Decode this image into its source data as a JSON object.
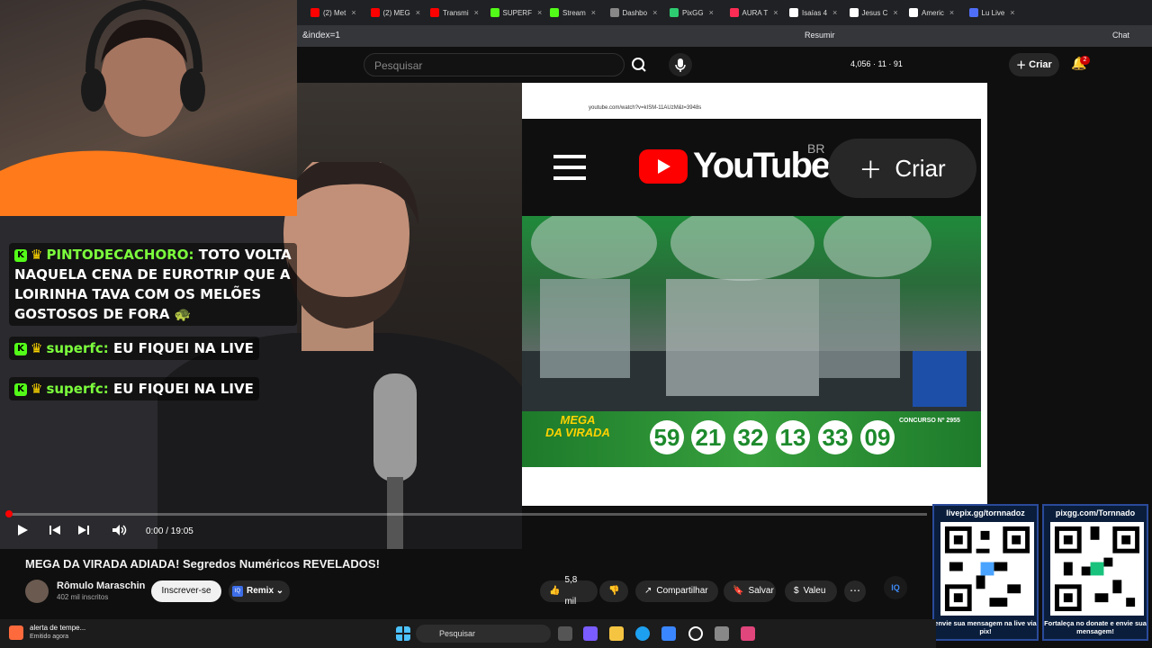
{
  "browser": {
    "tabs": [
      {
        "label": "(2) Met",
        "color": "#ff0000"
      },
      {
        "label": "(2) MEG",
        "color": "#ff0000"
      },
      {
        "label": "Transmi",
        "color": "#ff0000"
      },
      {
        "label": "SUPERF",
        "color": "#53fc18"
      },
      {
        "label": "Stream",
        "color": "#53fc18"
      },
      {
        "label": "Dashbo",
        "color": "#888888"
      },
      {
        "label": "PixGG",
        "color": "#2ecc71"
      },
      {
        "label": "AURA T",
        "color": "#ff2d55"
      },
      {
        "label": "Isaías 4",
        "color": "#ffffff"
      },
      {
        "label": "Jesus C",
        "color": "#ffffff"
      },
      {
        "label": "Americ",
        "color": "#ffffff"
      },
      {
        "label": "Lu Live",
        "color": "#4f6ef7"
      }
    ],
    "url": "&index=1",
    "resume_label": "Resumir",
    "chat_label": "Chat"
  },
  "youtube_header": {
    "search_placeholder": "Pesquisar",
    "stats": "4,056 · 11 · 91",
    "create_label": "Criar",
    "notification_count": "2"
  },
  "chat": [
    {
      "user": "PINTODECACHORO:",
      "text": "TOTO VOLTA NAQUELA CENA DE EUROTRIP QUE A LOIRINHA TAVA COM OS MELÕES GOSTOSOS DE FORA 🐢"
    },
    {
      "user": "superfc:",
      "text": "EU FIQUEI NA LIVE"
    },
    {
      "user": "superfc:",
      "text": "EU FIQUEI NA LIVE"
    }
  ],
  "inner_stream": {
    "url": "youtube.com/watch?v=kISM-11AUzM&t=3948s",
    "brand": "YouTube",
    "region": "BR",
    "create_label": "Criar",
    "lottery": {
      "logo_line1": "MEGA",
      "logo_line2": "DA VIRADA",
      "balls": [
        "59",
        "21",
        "32",
        "13",
        "33",
        "09"
      ],
      "concurso_label": "CONCURSO Nº",
      "concurso_number": "2955"
    }
  },
  "player": {
    "current_time": "0:00",
    "duration": "19:05",
    "time_text": "0:00 / 19:05",
    "progress_fraction": 0.003
  },
  "video_info": {
    "title": "MEGA DA VIRADA ADIADA! Segredos Numéricos REVELADOS!",
    "channel": "Rômulo Maraschin",
    "subscribers": "402 mil inscritos",
    "subscribe_label": "Inscrever-se",
    "remix_label": "Remix",
    "likes": "5,8 mil",
    "share_label": "Compartilhar",
    "save_label": "Salvar",
    "thanks_label": "Valeu"
  },
  "overlays": {
    "qr_left": {
      "title": "livepix.gg/tornnadoz",
      "footer": "envie sua mensagem na live via pix!"
    },
    "qr_right": {
      "title": "pixgg.com/Tornnado",
      "footer": "Fortaleça no donate e envie sua mensagem!"
    }
  },
  "taskbar": {
    "notification_title": "alerta de tempe...",
    "notification_sub": "Emitido agora",
    "search_label": "Pesquisar"
  }
}
